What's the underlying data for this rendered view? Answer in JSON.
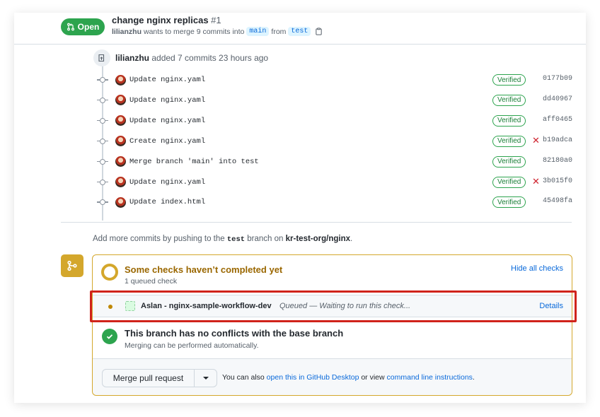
{
  "header": {
    "status_label": "Open",
    "title": "change nginx replicas",
    "number": "#1",
    "author": "lilianzhu",
    "merge_text": "wants to merge 9 commits into",
    "base_branch": "main",
    "from_text": "from",
    "head_branch": "test",
    "status_color": "#2da44e"
  },
  "timeline": {
    "push_author": "lilianzhu",
    "push_text": "added 7 commits 23 hours ago",
    "commits": [
      {
        "message": "Update nginx.yaml",
        "verified": "Verified",
        "failed": false,
        "sha": "0177b09"
      },
      {
        "message": "Update nginx.yaml",
        "verified": "Verified",
        "failed": false,
        "sha": "dd40967"
      },
      {
        "message": "Update nginx.yaml",
        "verified": "Verified",
        "failed": false,
        "sha": "aff0465"
      },
      {
        "message": "Create nginx.yaml",
        "verified": "Verified",
        "failed": true,
        "sha": "b19adca"
      },
      {
        "message": "Merge branch 'main' into test",
        "verified": "Verified",
        "failed": false,
        "sha": "82180a0"
      },
      {
        "message": "Update nginx.yaml",
        "verified": "Verified",
        "failed": true,
        "sha": "3b015f0"
      },
      {
        "message": "Update index.html",
        "verified": "Verified",
        "failed": false,
        "sha": "45498fa"
      }
    ],
    "failed_mark": "✕"
  },
  "add_commits": {
    "prefix": "Add more commits by pushing to the",
    "branch": "test",
    "middle": "branch on",
    "repo": "kr-test-org/nginx",
    "suffix": "."
  },
  "checks": {
    "title": "Some checks haven’t completed yet",
    "subtitle": "1 queued check",
    "hide_label": "Hide all checks",
    "item": {
      "name": "Aslan - nginx-sample-workflow-dev",
      "status": "Queued — Waiting to run this check...",
      "details_label": "Details"
    },
    "pending_color": "#d4a72c"
  },
  "conflicts": {
    "title": "This branch has no conflicts with the base branch",
    "subtitle": "Merging can be performed automatically."
  },
  "merge": {
    "button_label": "Merge pull request",
    "alt_prefix": "You can also",
    "desktop_link": "open this in GitHub Desktop",
    "alt_middle": "or view",
    "cli_link": "command line instructions",
    "alt_suffix": "."
  }
}
